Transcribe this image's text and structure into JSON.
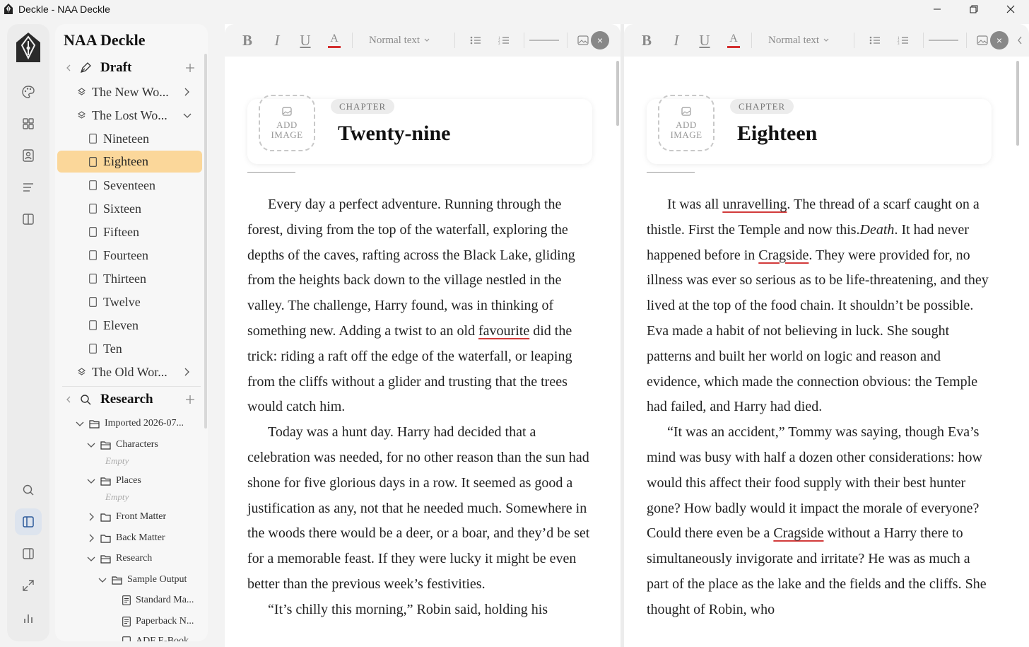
{
  "window": {
    "title": "Deckle - NAA Deckle"
  },
  "sidebar": {
    "project": "NAA Deckle",
    "draft": {
      "label": "Draft",
      "items": [
        {
          "label": "The New Wo..."
        },
        {
          "label": "The Lost Wo..."
        },
        {
          "label": "Nineteen"
        },
        {
          "label": "Eighteen"
        },
        {
          "label": "Seventeen"
        },
        {
          "label": "Sixteen"
        },
        {
          "label": "Fifteen"
        },
        {
          "label": "Fourteen"
        },
        {
          "label": "Thirteen"
        },
        {
          "label": "Twelve"
        },
        {
          "label": "Eleven"
        },
        {
          "label": "Ten"
        },
        {
          "label": "The Old Wor..."
        }
      ]
    },
    "research": {
      "label": "Research",
      "items": [
        {
          "label": "Imported 2026-07..."
        },
        {
          "label": "Characters"
        },
        {
          "label": "Empty"
        },
        {
          "label": "Places"
        },
        {
          "label": "Empty"
        },
        {
          "label": "Front Matter"
        },
        {
          "label": "Back Matter"
        },
        {
          "label": "Research"
        },
        {
          "label": "Sample Output"
        },
        {
          "label": "Standard Ma..."
        },
        {
          "label": "Paperback N..."
        },
        {
          "label": "ADF E-Book..."
        }
      ]
    }
  },
  "toolbar": {
    "bold": "B",
    "italic": "I",
    "underline": "U",
    "color": "A",
    "style_select": "Normal text",
    "close": "×",
    "text_color": "#d32f2f"
  },
  "left_pane": {
    "add_image_1": "ADD",
    "add_image_2": "IMAGE",
    "tag": "CHAPTER",
    "title": "Twenty-nine",
    "p1_a": "Every day a perfect adventure. Running through the forest, diving from the top of the waterfall, exploring the depths of the caves, rafting across the Black Lake, gliding from the heights back down to the village nestled in the valley. The challenge, Harry found, was in thinking of something new. Adding a twist to an old ",
    "p1_sp": "favourite",
    "p1_b": " did the trick: riding a raft off the edge of the waterfall, or leaping from the cliffs without a glider and trusting that the trees would catch him.",
    "p2": "Today was a hunt day. Harry had decided that a celebration was needed, for no other reason than the sun had shone for five glorious days in a row. It seemed as good a justification as any, not that he needed much. Somewhere in the woods there would be a deer, or a boar, and they’d be set for a memorable feast. If they were lucky it might be even better than the previous week’s festivities.",
    "p3": "“It’s chilly this morning,” Robin said, holding his"
  },
  "right_pane": {
    "add_image_1": "ADD",
    "add_image_2": "IMAGE",
    "tag": "CHAPTER",
    "title": "Eighteen",
    "p1_a": "It was all ",
    "p1_sp1": "unravelling",
    "p1_b": ". The thread of a scarf caught on a thistle. First the Temple and now this.",
    "p1_it": "Death",
    "p1_c": ". It had never happened before in ",
    "p1_sp2": "Cragside",
    "p1_d": ". They were provided for, no illness was ever so serious as to be life-threatening, and they lived at the top of the food chain. It shouldn’t be possible. Eva made a habit of not believing in luck. She sought patterns and built her world on logic and reason and evidence, which made the connection obvious: the Temple had failed, and Harry had died.",
    "p2_a": "“It was an accident,” Tommy was saying, though Eva’s mind was busy with half a dozen other considerations: how would this affect their food supply with their best hunter gone? How badly would it impact the morale of everyone? Could there even be a ",
    "p2_sp": "Cragside",
    "p2_b": " without a Harry there to simultaneously invigorate and irritate? He was as much a part of the place as the lake and the fields and the cliffs. She thought of Robin, who"
  }
}
